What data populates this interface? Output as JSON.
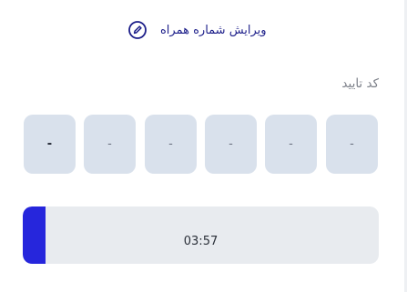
{
  "header": {
    "edit_phone_label": "ویرایش شماره همراه",
    "edit_icon": "pencil-circle-icon"
  },
  "verification": {
    "label": "کد تایید",
    "digits": [
      "-",
      "-",
      "-",
      "-",
      "-",
      "-"
    ]
  },
  "timer": {
    "remaining": "03:57",
    "progress_fraction": 0.064
  },
  "colors": {
    "accent": "#2626dc",
    "link": "#1d1f8a",
    "otp_box_bg": "#d9e1ec",
    "timer_bg": "#e8ebef"
  }
}
